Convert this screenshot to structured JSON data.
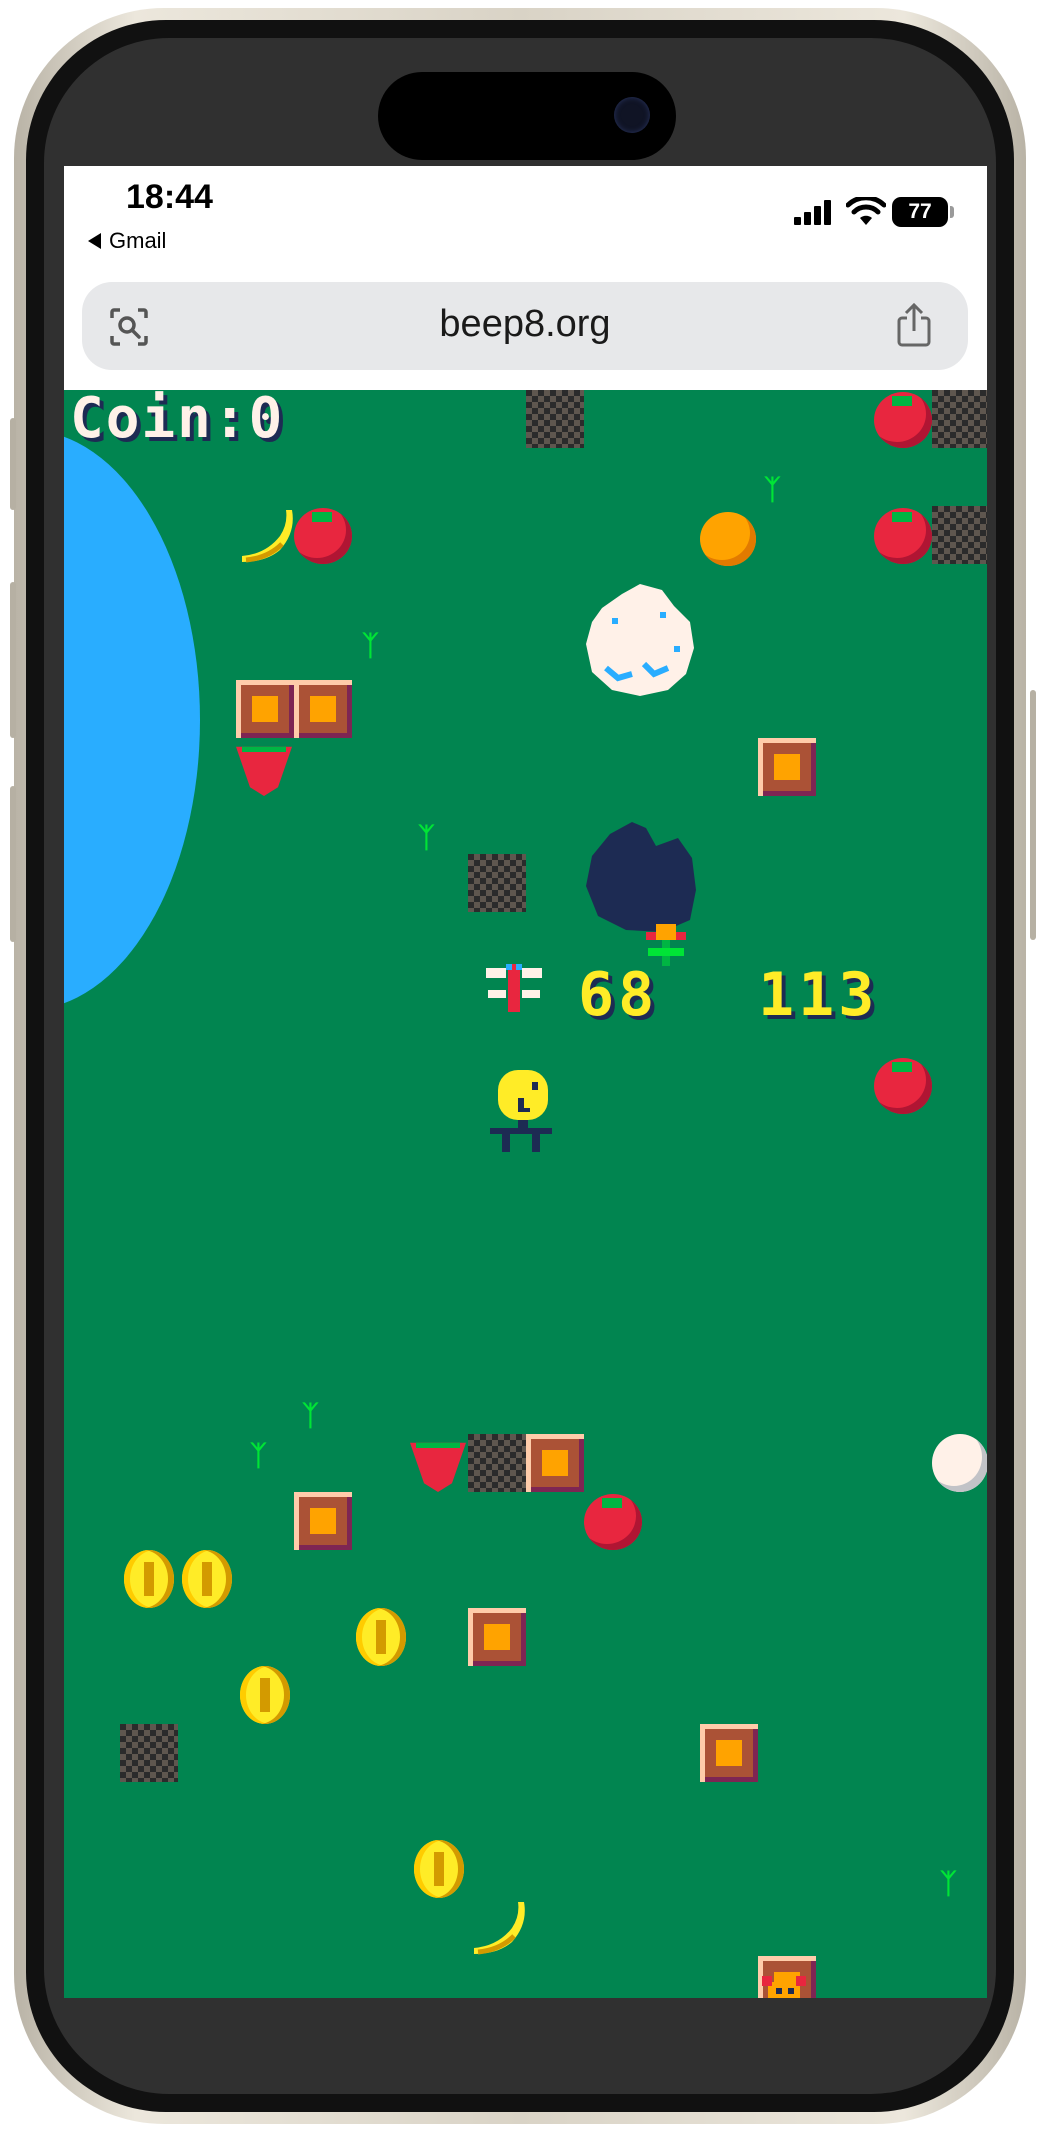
{
  "status_bar": {
    "time": "18:44",
    "back_app": "Gmail",
    "battery": "77"
  },
  "browser": {
    "url": "beep8.org"
  },
  "game": {
    "hud_coin_label": "Coin:0",
    "debug_x": "68",
    "debug_y": "113"
  },
  "colors": {
    "grass": "#018550",
    "lake": "#29adff",
    "hud_text": "#fff1e8",
    "debug_text": "#ffec27"
  },
  "icons": [
    "screen-search-icon",
    "share-icon",
    "signal-icon",
    "wifi-icon",
    "battery-icon"
  ]
}
